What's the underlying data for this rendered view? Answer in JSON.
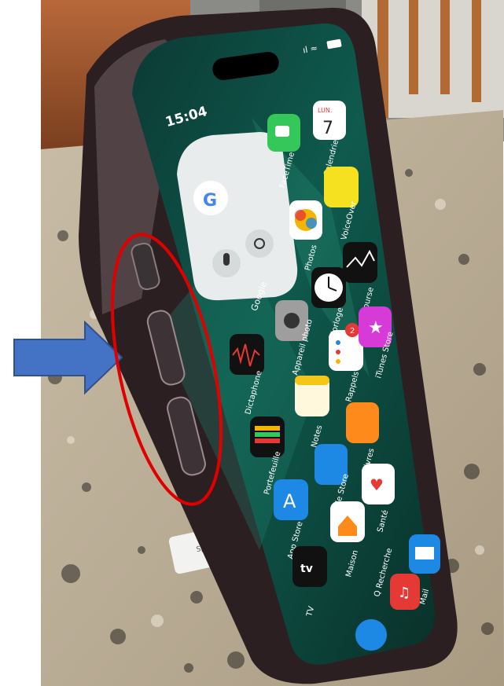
{
  "status_bar": {
    "time": "15:04"
  },
  "calendar_widget": {
    "weekday": "LUN.",
    "day": "7"
  },
  "search_widget": {
    "google_letter": "G",
    "label": "Google"
  },
  "apps": [
    {
      "label": "FaceTime"
    },
    {
      "label": "Calendrier"
    },
    {
      "label": "Photos"
    },
    {
      "label": "VoiceOver"
    },
    {
      "label": "Bourse"
    },
    {
      "label": "Horloge"
    },
    {
      "label": "Appareil photo"
    },
    {
      "label": "Dictaphone"
    },
    {
      "label": "Rappels",
      "badge": "2"
    },
    {
      "label": "iTunes Store"
    },
    {
      "label": "Notes"
    },
    {
      "label": "Portefeuille"
    },
    {
      "label": "Livres"
    },
    {
      "label": "App Store"
    },
    {
      "label": "Apple Store"
    },
    {
      "label": "Santé"
    },
    {
      "label": "Maison"
    },
    {
      "label": "TV",
      "glyph": "tv"
    },
    {
      "label": "Q Recherche"
    },
    {
      "label": "Mail"
    }
  ],
  "sticker": {
    "text": "Spigo"
  },
  "annotations": {
    "arrow_color": "#4472c4",
    "ellipse_color": "#e00000"
  }
}
